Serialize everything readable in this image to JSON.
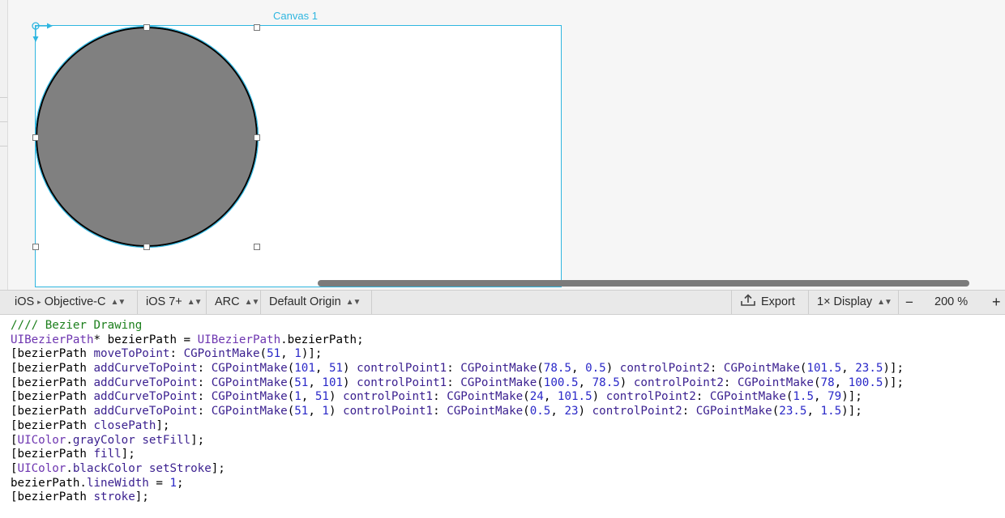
{
  "canvas": {
    "title": "Canvas 1",
    "shape": {
      "type": "ellipse",
      "fill_color": "#808080",
      "stroke_color": "#000000"
    },
    "selection_color": "#2fb6e0"
  },
  "toolbar": {
    "platform": "iOS",
    "language": "Objective-C",
    "target": "iOS 7+",
    "memory": "ARC",
    "origin": "Default Origin",
    "export_label": "Export",
    "display": "1× Display",
    "zoom_out_label": "−",
    "zoom_level": "200 %",
    "zoom_in_label": "+"
  },
  "code": {
    "lines": [
      [
        {
          "t": "//// Bezier Drawing",
          "k": "comment"
        }
      ],
      [
        {
          "t": "UIBezierPath",
          "k": "type"
        },
        {
          "t": "* bezierPath = ",
          "k": "plain"
        },
        {
          "t": "UIBezierPath",
          "k": "type"
        },
        {
          "t": ".bezierPath;",
          "k": "plain"
        }
      ],
      [
        {
          "t": "[bezierPath ",
          "k": "plain"
        },
        {
          "t": "moveToPoint",
          "k": "func"
        },
        {
          "t": ": ",
          "k": "plain"
        },
        {
          "t": "CGPointMake",
          "k": "func"
        },
        {
          "t": "(",
          "k": "plain"
        },
        {
          "t": "51",
          "k": "num"
        },
        {
          "t": ", ",
          "k": "plain"
        },
        {
          "t": "1",
          "k": "num"
        },
        {
          "t": ")];",
          "k": "plain"
        }
      ],
      [
        {
          "t": "[bezierPath ",
          "k": "plain"
        },
        {
          "t": "addCurveToPoint",
          "k": "func"
        },
        {
          "t": ": ",
          "k": "plain"
        },
        {
          "t": "CGPointMake",
          "k": "func"
        },
        {
          "t": "(",
          "k": "plain"
        },
        {
          "t": "101",
          "k": "num"
        },
        {
          "t": ", ",
          "k": "plain"
        },
        {
          "t": "51",
          "k": "num"
        },
        {
          "t": ") ",
          "k": "plain"
        },
        {
          "t": "controlPoint1",
          "k": "func"
        },
        {
          "t": ": ",
          "k": "plain"
        },
        {
          "t": "CGPointMake",
          "k": "func"
        },
        {
          "t": "(",
          "k": "plain"
        },
        {
          "t": "78.5",
          "k": "num"
        },
        {
          "t": ", ",
          "k": "plain"
        },
        {
          "t": "0.5",
          "k": "num"
        },
        {
          "t": ") ",
          "k": "plain"
        },
        {
          "t": "controlPoint2",
          "k": "func"
        },
        {
          "t": ": ",
          "k": "plain"
        },
        {
          "t": "CGPointMake",
          "k": "func"
        },
        {
          "t": "(",
          "k": "plain"
        },
        {
          "t": "101.5",
          "k": "num"
        },
        {
          "t": ", ",
          "k": "plain"
        },
        {
          "t": "23.5",
          "k": "num"
        },
        {
          "t": ")];",
          "k": "plain"
        }
      ],
      [
        {
          "t": "[bezierPath ",
          "k": "plain"
        },
        {
          "t": "addCurveToPoint",
          "k": "func"
        },
        {
          "t": ": ",
          "k": "plain"
        },
        {
          "t": "CGPointMake",
          "k": "func"
        },
        {
          "t": "(",
          "k": "plain"
        },
        {
          "t": "51",
          "k": "num"
        },
        {
          "t": ", ",
          "k": "plain"
        },
        {
          "t": "101",
          "k": "num"
        },
        {
          "t": ") ",
          "k": "plain"
        },
        {
          "t": "controlPoint1",
          "k": "func"
        },
        {
          "t": ": ",
          "k": "plain"
        },
        {
          "t": "CGPointMake",
          "k": "func"
        },
        {
          "t": "(",
          "k": "plain"
        },
        {
          "t": "100.5",
          "k": "num"
        },
        {
          "t": ", ",
          "k": "plain"
        },
        {
          "t": "78.5",
          "k": "num"
        },
        {
          "t": ") ",
          "k": "plain"
        },
        {
          "t": "controlPoint2",
          "k": "func"
        },
        {
          "t": ": ",
          "k": "plain"
        },
        {
          "t": "CGPointMake",
          "k": "func"
        },
        {
          "t": "(",
          "k": "plain"
        },
        {
          "t": "78",
          "k": "num"
        },
        {
          "t": ", ",
          "k": "plain"
        },
        {
          "t": "100.5",
          "k": "num"
        },
        {
          "t": ")];",
          "k": "plain"
        }
      ],
      [
        {
          "t": "[bezierPath ",
          "k": "plain"
        },
        {
          "t": "addCurveToPoint",
          "k": "func"
        },
        {
          "t": ": ",
          "k": "plain"
        },
        {
          "t": "CGPointMake",
          "k": "func"
        },
        {
          "t": "(",
          "k": "plain"
        },
        {
          "t": "1",
          "k": "num"
        },
        {
          "t": ", ",
          "k": "plain"
        },
        {
          "t": "51",
          "k": "num"
        },
        {
          "t": ") ",
          "k": "plain"
        },
        {
          "t": "controlPoint1",
          "k": "func"
        },
        {
          "t": ": ",
          "k": "plain"
        },
        {
          "t": "CGPointMake",
          "k": "func"
        },
        {
          "t": "(",
          "k": "plain"
        },
        {
          "t": "24",
          "k": "num"
        },
        {
          "t": ", ",
          "k": "plain"
        },
        {
          "t": "101.5",
          "k": "num"
        },
        {
          "t": ") ",
          "k": "plain"
        },
        {
          "t": "controlPoint2",
          "k": "func"
        },
        {
          "t": ": ",
          "k": "plain"
        },
        {
          "t": "CGPointMake",
          "k": "func"
        },
        {
          "t": "(",
          "k": "plain"
        },
        {
          "t": "1.5",
          "k": "num"
        },
        {
          "t": ", ",
          "k": "plain"
        },
        {
          "t": "79",
          "k": "num"
        },
        {
          "t": ")];",
          "k": "plain"
        }
      ],
      [
        {
          "t": "[bezierPath ",
          "k": "plain"
        },
        {
          "t": "addCurveToPoint",
          "k": "func"
        },
        {
          "t": ": ",
          "k": "plain"
        },
        {
          "t": "CGPointMake",
          "k": "func"
        },
        {
          "t": "(",
          "k": "plain"
        },
        {
          "t": "51",
          "k": "num"
        },
        {
          "t": ", ",
          "k": "plain"
        },
        {
          "t": "1",
          "k": "num"
        },
        {
          "t": ") ",
          "k": "plain"
        },
        {
          "t": "controlPoint1",
          "k": "func"
        },
        {
          "t": ": ",
          "k": "plain"
        },
        {
          "t": "CGPointMake",
          "k": "func"
        },
        {
          "t": "(",
          "k": "plain"
        },
        {
          "t": "0.5",
          "k": "num"
        },
        {
          "t": ", ",
          "k": "plain"
        },
        {
          "t": "23",
          "k": "num"
        },
        {
          "t": ") ",
          "k": "plain"
        },
        {
          "t": "controlPoint2",
          "k": "func"
        },
        {
          "t": ": ",
          "k": "plain"
        },
        {
          "t": "CGPointMake",
          "k": "func"
        },
        {
          "t": "(",
          "k": "plain"
        },
        {
          "t": "23.5",
          "k": "num"
        },
        {
          "t": ", ",
          "k": "plain"
        },
        {
          "t": "1.5",
          "k": "num"
        },
        {
          "t": ")];",
          "k": "plain"
        }
      ],
      [
        {
          "t": "[bezierPath ",
          "k": "plain"
        },
        {
          "t": "closePath",
          "k": "func"
        },
        {
          "t": "];",
          "k": "plain"
        }
      ],
      [
        {
          "t": "[",
          "k": "plain"
        },
        {
          "t": "UIColor",
          "k": "type"
        },
        {
          "t": ".",
          "k": "plain"
        },
        {
          "t": "grayColor",
          "k": "func"
        },
        {
          "t": " ",
          "k": "plain"
        },
        {
          "t": "setFill",
          "k": "func"
        },
        {
          "t": "];",
          "k": "plain"
        }
      ],
      [
        {
          "t": "[bezierPath ",
          "k": "plain"
        },
        {
          "t": "fill",
          "k": "func"
        },
        {
          "t": "];",
          "k": "plain"
        }
      ],
      [
        {
          "t": "[",
          "k": "plain"
        },
        {
          "t": "UIColor",
          "k": "type"
        },
        {
          "t": ".",
          "k": "plain"
        },
        {
          "t": "blackColor",
          "k": "func"
        },
        {
          "t": " ",
          "k": "plain"
        },
        {
          "t": "setStroke",
          "k": "func"
        },
        {
          "t": "];",
          "k": "plain"
        }
      ],
      [
        {
          "t": "bezierPath.",
          "k": "plain"
        },
        {
          "t": "lineWidth",
          "k": "func"
        },
        {
          "t": " = ",
          "k": "plain"
        },
        {
          "t": "1",
          "k": "num"
        },
        {
          "t": ";",
          "k": "plain"
        }
      ],
      [
        {
          "t": "[bezierPath ",
          "k": "plain"
        },
        {
          "t": "stroke",
          "k": "func"
        },
        {
          "t": "];",
          "k": "plain"
        }
      ]
    ]
  }
}
